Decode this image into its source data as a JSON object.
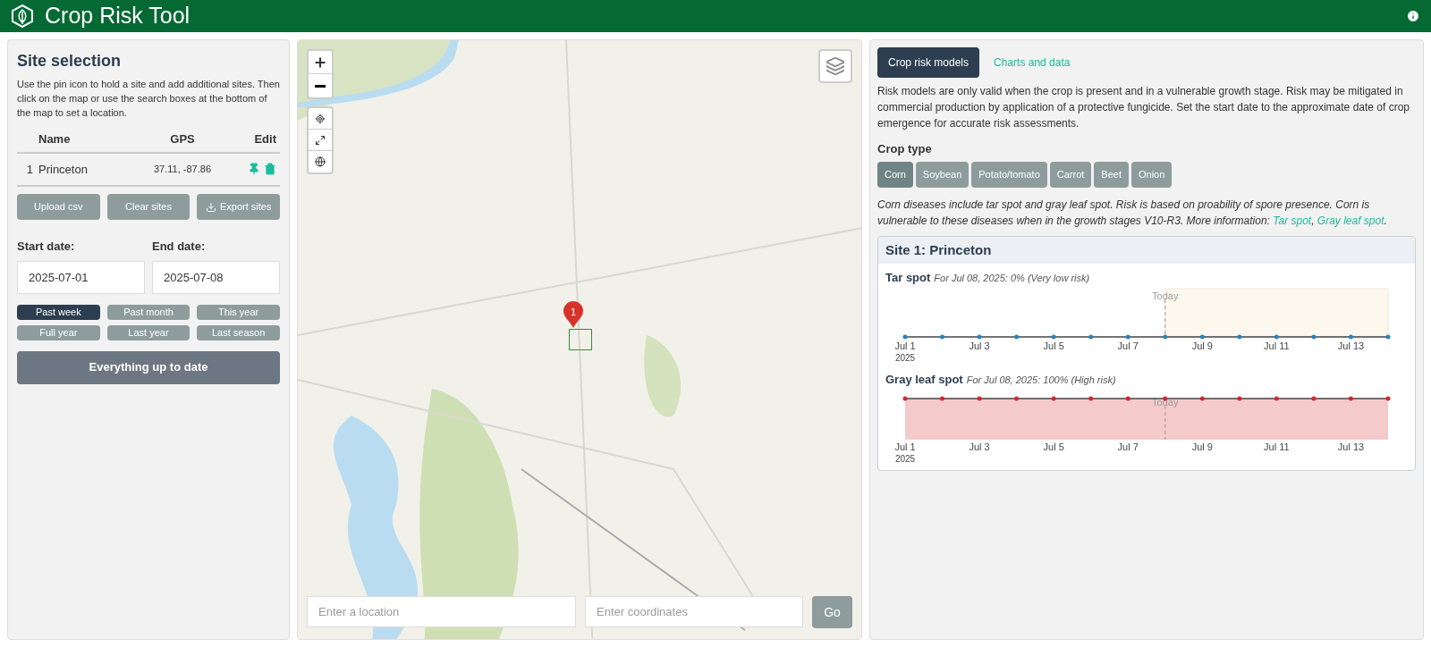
{
  "header": {
    "title": "Crop Risk Tool"
  },
  "site_selection": {
    "title": "Site selection",
    "instructions": "Use the pin icon to hold a site and add additional sites. Then click on the map or use the search boxes at the bottom of the map to set a location.",
    "columns": [
      "Name",
      "GPS",
      "Edit"
    ],
    "sites": [
      {
        "index": "1",
        "name": "Princeton",
        "gps": "37.11, -87.86",
        "pinned": true
      }
    ],
    "buttons": [
      {
        "label": "Upload csv",
        "kind": "plain"
      },
      {
        "label": "Clear sites",
        "kind": "plain"
      },
      {
        "label": "Export sites",
        "kind": "download"
      }
    ],
    "start_label": "Start date:",
    "start_value": "2025-07-01",
    "end_label": "End date:",
    "end_value": "2025-07-08",
    "ranges": [
      {
        "label": "Past week",
        "selected": true
      },
      {
        "label": "Past month",
        "selected": false
      },
      {
        "label": "This year",
        "selected": false
      },
      {
        "label": "Full year",
        "selected": false
      },
      {
        "label": "Last year",
        "selected": false
      },
      {
        "label": "Last season",
        "selected": false
      }
    ],
    "update_button": "Everything up to date"
  },
  "map": {
    "marker": "1",
    "location_placeholder": "Enter a location",
    "coordinates_placeholder": "Enter coordinates",
    "go_button": "Go"
  },
  "tabs": [
    {
      "label": "Crop risk models",
      "selected": true
    },
    {
      "label": "Charts and data",
      "selected": false
    }
  ],
  "description": "Risk models are only valid when the crop is present and in a vulnerable growth stage. Risk may be mitigated in commercial production by application of a protective fungicide. Set the start date to the approximate date of crop emergence for accurate risk assessments.",
  "crop_type": {
    "label": "Crop type",
    "options": [
      {
        "label": "Corn",
        "selected": true
      },
      {
        "label": "Soybean",
        "selected": false
      },
      {
        "label": "Potato/tomato",
        "selected": false
      },
      {
        "label": "Carrot",
        "selected": false
      },
      {
        "label": "Beet",
        "selected": false
      },
      {
        "label": "Onion",
        "selected": false
      }
    ]
  },
  "note_parts": [
    {
      "kind": "text",
      "text": "Corn diseases include tar spot and gray leaf spot. Risk is based on proability of spore presence. Corn is vulnerable to these diseases when in the growth stages V10-R3. More information: "
    },
    {
      "kind": "link",
      "text": "Tar spot"
    },
    {
      "kind": "text",
      "text": ", "
    },
    {
      "kind": "link",
      "text": "Gray leaf spot"
    },
    {
      "kind": "text",
      "text": "."
    }
  ],
  "site_card": {
    "title": "Site 1: Princeton",
    "diseases": [
      {
        "name": "Tar spot",
        "summary": "For Jul 08, 2025: 0% (Very low risk)",
        "kind": "low",
        "today_label": "Today",
        "year_label": "2025",
        "x_labels": [
          "Jul 1",
          "Jul 3",
          "Jul 5",
          "Jul 7",
          "Jul 9",
          "Jul 11",
          "Jul 13"
        ]
      },
      {
        "name": "Gray leaf spot",
        "summary": "For Jul 08, 2025: 100% (High risk)",
        "kind": "high",
        "today_label": "Today",
        "year_label": "2025",
        "x_labels": [
          "Jul 1",
          "Jul 3",
          "Jul 5",
          "Jul 7",
          "Jul 9",
          "Jul 11",
          "Jul 13"
        ]
      }
    ]
  }
}
